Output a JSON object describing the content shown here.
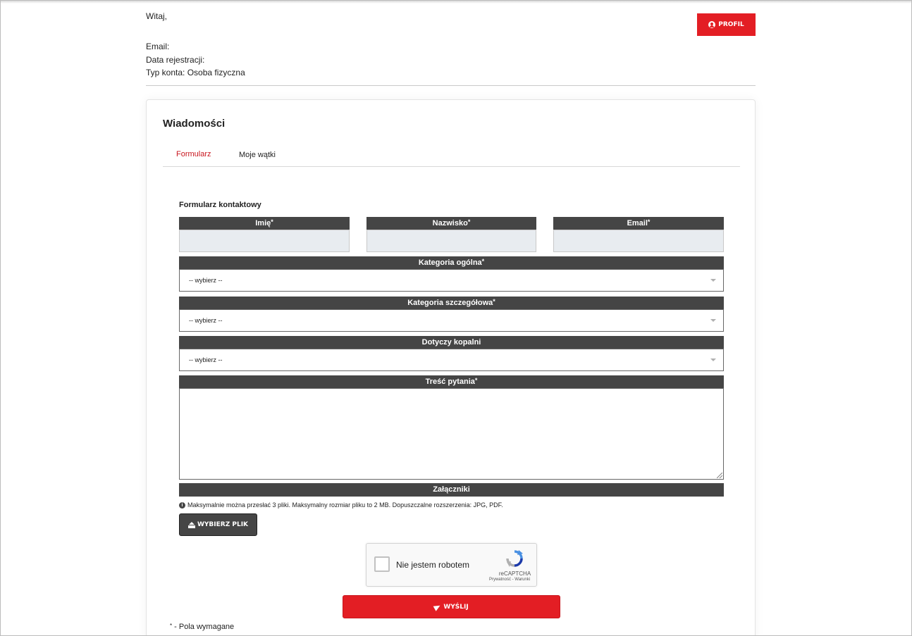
{
  "user": {
    "greeting": "Witaj,",
    "email_label": "Email:",
    "registration_label": "Data rejestracji:",
    "account_type_label": "Typ konta: Osoba fizyczna",
    "profile_button": "PROFIL"
  },
  "card": {
    "title": "Wiadomości",
    "tabs": [
      {
        "label": "Formularz",
        "active": true
      },
      {
        "label": "Moje wątki",
        "active": false
      }
    ]
  },
  "form": {
    "title": "Formularz kontaktowy",
    "fields": {
      "first_name": {
        "label": "Imię",
        "required_mark": "*",
        "value": ""
      },
      "last_name": {
        "label": "Nazwisko",
        "required_mark": "*",
        "value": ""
      },
      "email": {
        "label": "Email",
        "required_mark": "*",
        "value": ""
      },
      "general_category": {
        "label": "Kategoria ogólna",
        "required_mark": "*",
        "selected": "-- wybierz --"
      },
      "detailed_category": {
        "label": "Kategoria szczegółowa",
        "required_mark": "*",
        "selected": "-- wybierz --"
      },
      "mine": {
        "label": "Dotyczy kopalni",
        "selected": "-- wybierz --"
      },
      "question": {
        "label": "Treść pytania",
        "required_mark": "*",
        "value": ""
      },
      "attachments": {
        "label": "Załączniki"
      }
    },
    "attachments_hint": "Maksymalnie można przesłać 3 pliki. Maksymalny rozmiar pliku to 2 MB. Dopuszczalne rozszerzenia: JPG, PDF.",
    "upload_button": "WYBIERZ PLIK",
    "recaptcha": {
      "label": "Nie jestem robotem",
      "brand": "reCAPTCHA",
      "terms": "Prywatność - Warunki"
    },
    "send_button": "WYŚLIJ",
    "required_note_mark": "*",
    "required_note": " - Pola wymagane"
  },
  "colors": {
    "accent": "#e31e24",
    "header_bar": "#454545",
    "input_bg": "#e8ecf0"
  }
}
